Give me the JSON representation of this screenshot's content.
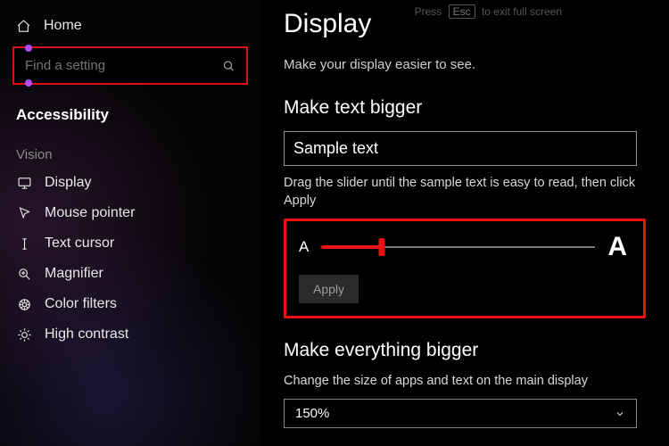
{
  "sidebar": {
    "home": "Home",
    "search_placeholder": "Find a setting",
    "category": "Accessibility",
    "group": "Vision",
    "items": [
      {
        "label": "Display"
      },
      {
        "label": "Mouse pointer"
      },
      {
        "label": "Text cursor"
      },
      {
        "label": "Magnifier"
      },
      {
        "label": "Color filters"
      },
      {
        "label": "High contrast"
      }
    ]
  },
  "hint": {
    "prefix": "Press",
    "key": "Esc",
    "suffix": "to exit full screen"
  },
  "main": {
    "title": "Display",
    "subtitle": "Make your display easier to see.",
    "text_bigger": {
      "heading": "Make text bigger",
      "sample": "Sample text",
      "instruction": "Drag the slider until the sample text is easy to read, then click Apply",
      "small_a": "A",
      "big_a": "A",
      "apply": "Apply"
    },
    "everything_bigger": {
      "heading": "Make everything bigger",
      "description": "Change the size of apps and text on the main display",
      "value": "150%"
    }
  }
}
